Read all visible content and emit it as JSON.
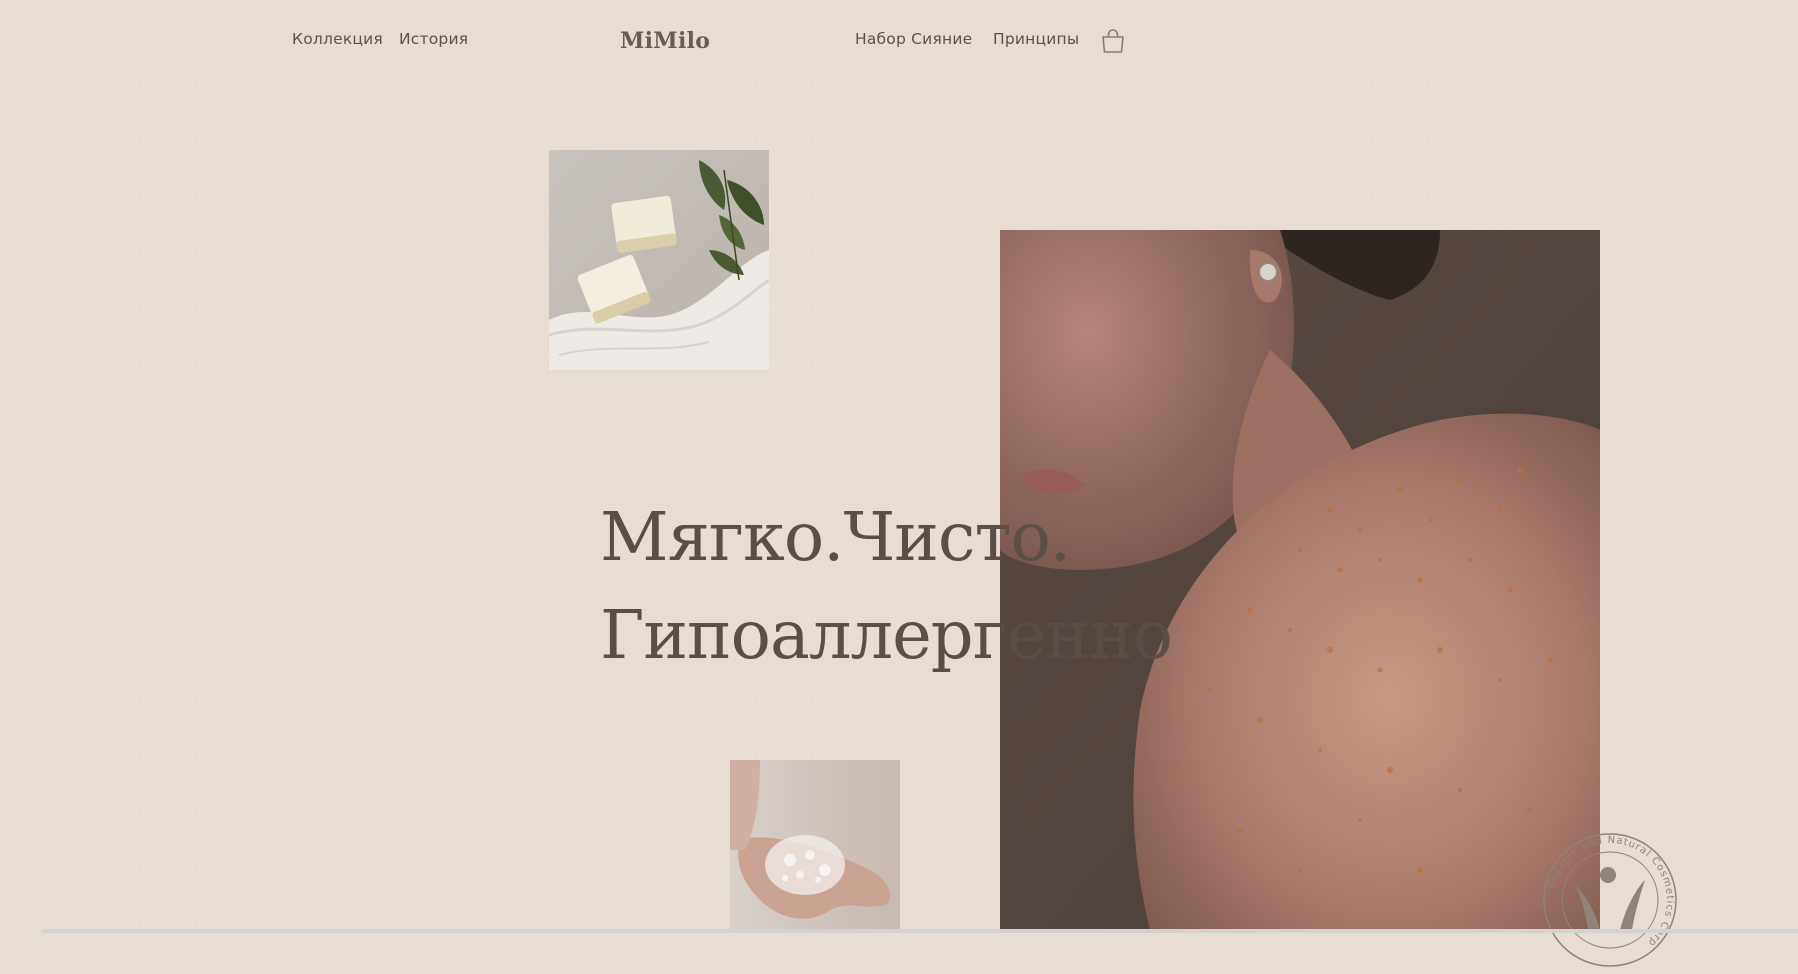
{
  "header": {
    "nav_left": [
      "Коллекция",
      "История"
    ],
    "logo": "MiMilo",
    "nav_right": [
      "Набор Сияние",
      "Принципы"
    ],
    "cart_icon": "shopping-bag-icon"
  },
  "hero": {
    "headline_line1": "Мягко.Чисто.",
    "headline_line2": "Гипоаллергенно"
  },
  "images": {
    "soap": "soap-bars-photo",
    "portrait": "freckled-shoulder-portrait-photo",
    "hand": "hand-with-foam-photo"
  },
  "badge": {
    "text": "Organic and Natural Cosmetics Corp"
  },
  "colors": {
    "background": "#e8ddd3",
    "text": "#5b4e46",
    "accent": "#6a5c54"
  }
}
